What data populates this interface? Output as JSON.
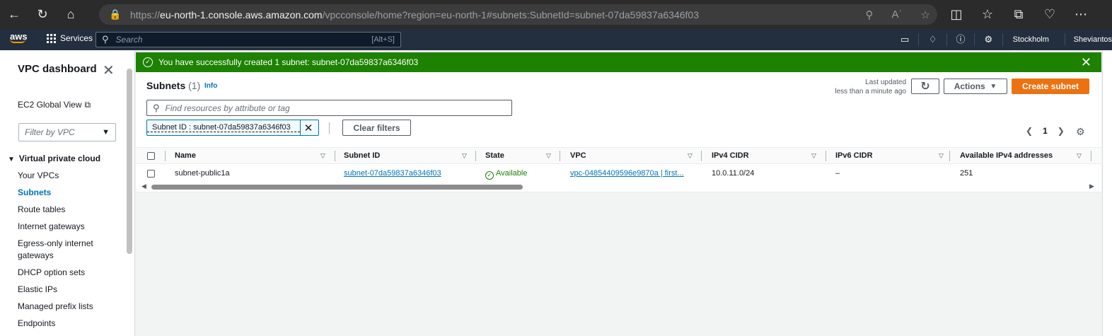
{
  "browser": {
    "url_prefix": "https://",
    "url_host": "eu-north-1.console.aws.amazon.com",
    "url_path": "/vpcconsole/home?region=eu-north-1#subnets:SubnetId=subnet-07da59837a6346f03"
  },
  "aws_nav": {
    "logo": "aws",
    "services": "Services",
    "search_placeholder": "Search",
    "search_shortcut": "[Alt+S]",
    "region": "Stockholm ▾",
    "user": "Sheviantos"
  },
  "sidebar": {
    "title": "VPC dashboard",
    "global_view": "EC2 Global View",
    "filter_placeholder": "Filter by VPC",
    "section": "Virtual private cloud",
    "items": [
      {
        "label": "Your VPCs"
      },
      {
        "label": "Subnets"
      },
      {
        "label": "Route tables"
      },
      {
        "label": "Internet gateways"
      },
      {
        "label": "Egress-only internet gateways"
      },
      {
        "label": "DHCP option sets"
      },
      {
        "label": "Elastic IPs"
      },
      {
        "label": "Managed prefix lists"
      },
      {
        "label": "Endpoints"
      }
    ]
  },
  "flash": {
    "message": "You have successfully created 1 subnet: subnet-07da59837a6346f03"
  },
  "panel": {
    "title": "Subnets",
    "count": "(1)",
    "info": "Info",
    "last_updated_label": "Last updated",
    "last_updated_value": "less than a minute ago",
    "actions_label": "Actions",
    "create_label": "Create subnet",
    "find_placeholder": "Find resources by attribute or tag",
    "token": "Subnet ID : subnet-07da59837a6346f03",
    "clear_filters": "Clear filters",
    "page_number": "1"
  },
  "table": {
    "columns": [
      "Name",
      "Subnet ID",
      "State",
      "VPC",
      "IPv4 CIDR",
      "IPv6 CIDR",
      "Available IPv4 addresses"
    ],
    "rows": [
      {
        "name": "subnet-public1a",
        "subnet_id": "subnet-07da59837a6346f03",
        "state": "Available",
        "vpc": "vpc-04854409596e9870a | first...",
        "ipv4_cidr": "10.0.11.0/24",
        "ipv6_cidr": "–",
        "available_ipv4": "251"
      }
    ]
  },
  "colors": {
    "success": "#1d8102",
    "link": "#0073bb",
    "primary_button": "#ec7211",
    "nav_bg": "#232f3e"
  }
}
